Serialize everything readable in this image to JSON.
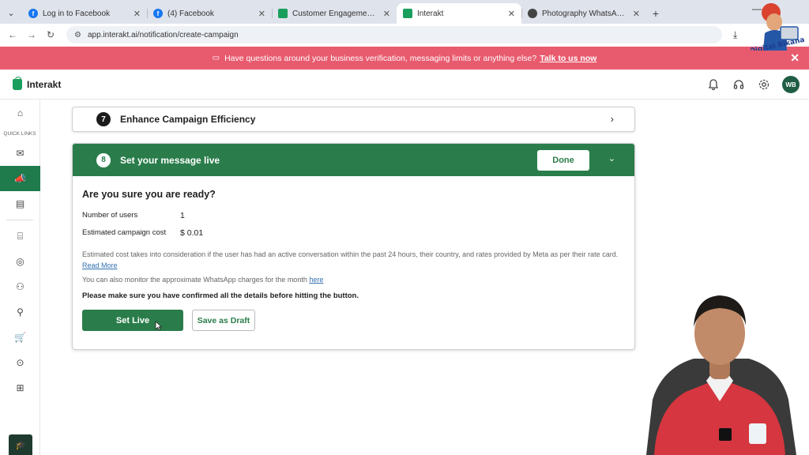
{
  "browser": {
    "tabs": [
      {
        "title": "Log in to Facebook",
        "favicon_color": "#1877f2",
        "favicon_letter": "f",
        "active": false
      },
      {
        "title": "(4) Facebook",
        "favicon_color": "#1877f2",
        "favicon_letter": "f",
        "active": false
      },
      {
        "title": "Customer Engagement Simplifi",
        "favicon_color": "#1a9e5c",
        "favicon_letter": "",
        "active": false
      },
      {
        "title": "Interakt",
        "favicon_color": "#1a9e5c",
        "favicon_letter": "",
        "active": true
      },
      {
        "title": "Photography WhatsApp Welco",
        "favicon_color": "#444444",
        "favicon_letter": "",
        "active": false
      }
    ],
    "url": "app.interakt.ai/notification/create-campaign"
  },
  "banner": {
    "text": "Have questions around your business verification, messaging limits or anything else?",
    "link": "Talk to us now"
  },
  "app": {
    "name": "Interakt",
    "avatar_initials": "WB"
  },
  "sidebar": {
    "quick_links_label": "QUICK LINKS"
  },
  "step7": {
    "number": "7",
    "title": "Enhance Campaign Efficiency"
  },
  "step8": {
    "number": "8",
    "title": "Set your message live",
    "done_label": "Done",
    "heading": "Are you sure you are ready?",
    "users_label": "Number of users",
    "users_value": "1",
    "cost_label": "Estimated campaign cost",
    "cost_value": "$ 0.01",
    "note": "Estimated cost takes into consideration if the user has had an active conversation within the past 24 hours, their country, and rates provided by Meta as per their rate card.",
    "read_more": "Read More",
    "monitor_text": "You can also monitor the approximate WhatsApp charges for the month",
    "monitor_link": "here",
    "confirm_text": "Please make sure you have confirmed all the details before hitting the button.",
    "set_live_label": "Set Live",
    "save_draft_label": "Save as Draft"
  },
  "overlay": {
    "channel_logo_text": "Digital Bikana"
  },
  "colors": {
    "brand_green": "#2a7d4b",
    "banner_red": "#e85b6e"
  }
}
